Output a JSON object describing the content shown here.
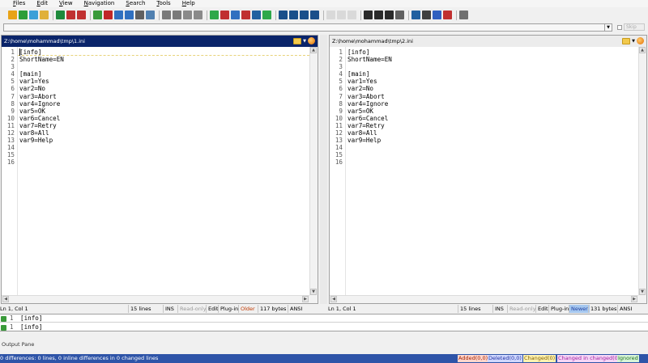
{
  "menu": {
    "items": [
      {
        "first": "F",
        "rest": "iles"
      },
      {
        "first": "E",
        "rest": "dit"
      },
      {
        "first": "V",
        "rest": "iew"
      },
      {
        "first": "N",
        "rest": "avigation"
      },
      {
        "first": "S",
        "rest": "earch"
      },
      {
        "first": "T",
        "rest": "ools"
      },
      {
        "first": "H",
        "rest": "elp"
      }
    ]
  },
  "filter": {
    "skip_label": "Skip"
  },
  "left_pane": {
    "path": "Z:\\home\\mohammad\\tmp\\1.ini",
    "line_numbers": [
      "1",
      "2",
      "3",
      "4",
      "5",
      "6",
      "7",
      "8",
      "9",
      "10",
      "11",
      "12",
      "13",
      "14",
      "15",
      "16"
    ],
    "lines": [
      "[info]",
      "ShortName=EN",
      "",
      "[main]",
      "var1=Yes",
      "var2=No",
      "var3=Abort",
      "var4=Ignore",
      "var5=OK",
      "var6=Cancel",
      "var7=Retry",
      "var8=All",
      "var9=Help",
      "",
      "",
      ""
    ],
    "status": {
      "position": "Ln 1, Col 1",
      "lines": "15 lines",
      "mode": "INS",
      "readonly": "Read-only",
      "edit": "Edit",
      "plugin": "Plug-in",
      "age": "Older",
      "size": "117 bytes",
      "encoding": "ANSI"
    }
  },
  "right_pane": {
    "path": "Z:\\home\\mohammad\\tmp\\2.ini",
    "line_numbers": [
      "1",
      "2",
      "3",
      "4",
      "5",
      "6",
      "7",
      "8",
      "9",
      "10",
      "11",
      "12",
      "13",
      "14",
      "15",
      "16"
    ],
    "lines": [
      "[info]",
      "ShortName=EN",
      "",
      "[main]",
      "var1=Yes",
      "var2=No",
      "var3=Abort",
      "var4=Ignore",
      "var5=OK",
      "var6=Cancel",
      "var7=Retry",
      "var8=All",
      "var9=Help",
      "",
      "",
      ""
    ],
    "status": {
      "position": "Ln 1, Col 1",
      "lines": "15 lines",
      "mode": "INS",
      "readonly": "Read-only",
      "edit": "Edit",
      "plugin": "Plug-in",
      "age": "Newer",
      "size": "131 bytes",
      "encoding": "ANSI"
    }
  },
  "diff_rows": [
    {
      "num": "1",
      "text": "[info]"
    },
    {
      "num": "1",
      "text": "[info]"
    }
  ],
  "output_pane": {
    "label": "Output Pane"
  },
  "bottom": {
    "message": "0 differences: 0 lines, 0 inline differences in 0 changed lines",
    "added": "Added(0,0)",
    "deleted": "Deleted(0,0)",
    "changed": "Changed(0)",
    "changed_in_changed": "Changed in changed(0)",
    "ignored": "Ignored"
  },
  "toolbar_icons": [
    {
      "name": "open-icon",
      "color": "#e8a317"
    },
    {
      "name": "refresh-icon",
      "color": "#2e9e3a"
    },
    {
      "name": "reload-icon",
      "color": "#3ba0d8"
    },
    {
      "name": "open-folder-icon",
      "color": "#e0b03a"
    },
    {
      "name": "sep"
    },
    {
      "name": "save-icon",
      "color": "#1e8a3c"
    },
    {
      "name": "save-as-icon",
      "color": "#c03030"
    },
    {
      "name": "save-all-icon",
      "color": "#c03030"
    },
    {
      "name": "sep"
    },
    {
      "name": "edit-icon",
      "color": "#3a9a3a"
    },
    {
      "name": "edit-pen-icon",
      "color": "#c02828"
    },
    {
      "name": "copy-left-icon",
      "color": "#3070c0"
    },
    {
      "name": "copy-right-icon",
      "color": "#3070c0"
    },
    {
      "name": "print-icon",
      "color": "#606060"
    },
    {
      "name": "print-preview-icon",
      "color": "#5080b0"
    },
    {
      "name": "sep"
    },
    {
      "name": "undo-icon",
      "color": "#7a7a7a"
    },
    {
      "name": "redo-icon",
      "color": "#7a7a7a"
    },
    {
      "name": "next-arrow-icon",
      "color": "#8a8a8a"
    },
    {
      "name": "prev-arrow-icon",
      "color": "#8a8a8a"
    },
    {
      "name": "sep"
    },
    {
      "name": "layout-single-icon",
      "color": "#2ea84a"
    },
    {
      "name": "layout-horizontal-icon",
      "color": "#c03030"
    },
    {
      "name": "layout-vertical-icon",
      "color": "#3070c0"
    },
    {
      "name": "layout-grid-icon",
      "color": "#c03030"
    },
    {
      "name": "sync-scroll-icon",
      "color": "#2060a0"
    },
    {
      "name": "check-icon",
      "color": "#2ea84a"
    },
    {
      "name": "sep"
    },
    {
      "name": "filter-icon",
      "color": "#1a4f8a"
    },
    {
      "name": "filter-next-icon",
      "color": "#1a4f8a"
    },
    {
      "name": "filter-prev-icon",
      "color": "#1a4f8a"
    },
    {
      "name": "filter-clear-icon",
      "color": "#1a4f8a"
    },
    {
      "name": "sep"
    },
    {
      "name": "up-arrow-icon",
      "color": "#b0b0b0",
      "disabled": true
    },
    {
      "name": "stop-icon",
      "color": "#b0b0b0",
      "disabled": true
    },
    {
      "name": "down-arrow-icon",
      "color": "#b0b0b0",
      "disabled": true
    },
    {
      "name": "sep"
    },
    {
      "name": "binoculars-icon",
      "color": "#2a2a2a"
    },
    {
      "name": "binoculars-next-icon",
      "color": "#2a2a2a"
    },
    {
      "name": "binoculars-prev-icon",
      "color": "#2a2a2a"
    },
    {
      "name": "font-size-icon",
      "color": "#606060"
    },
    {
      "name": "sep"
    },
    {
      "name": "options-icon",
      "color": "#2060a0"
    },
    {
      "name": "list-icon",
      "color": "#404040"
    },
    {
      "name": "plugins-icon",
      "color": "#3060c0"
    },
    {
      "name": "compare-icon",
      "color": "#c03030"
    },
    {
      "name": "sep"
    },
    {
      "name": "gear-icon",
      "color": "#707070"
    }
  ]
}
